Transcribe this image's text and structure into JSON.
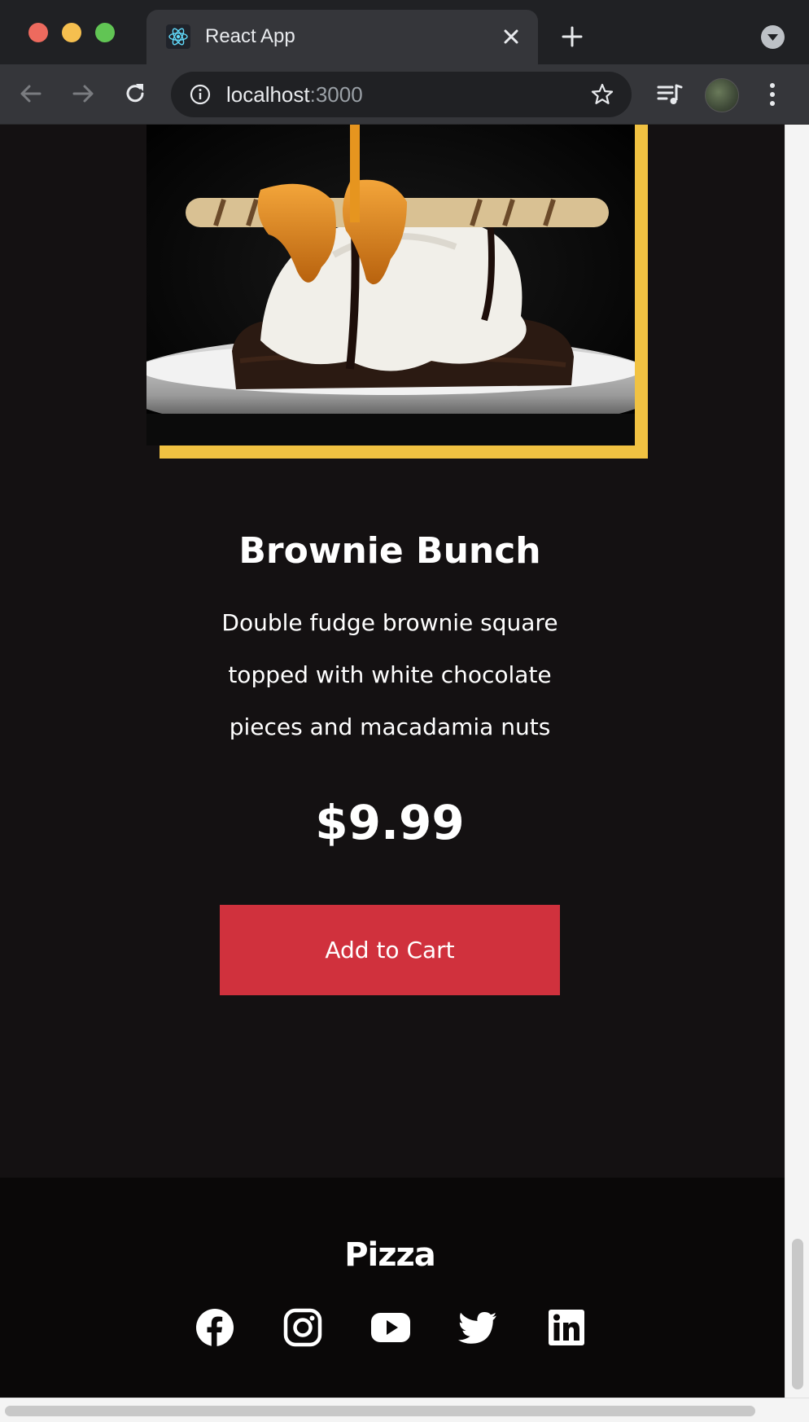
{
  "browser": {
    "tab_title": "React App",
    "url_host": "localhost",
    "url_port": ":3000"
  },
  "product": {
    "image_alt": "Brownie with ice cream, caramel and chocolate drizzle",
    "title": "Brownie Bunch",
    "description": "Double fudge brownie square topped with white chocolate pieces and macadamia nuts",
    "price": "$9.99",
    "cart_label": "Add to Cart"
  },
  "footer": {
    "logo": "Pizza",
    "social": [
      "facebook-icon",
      "instagram-icon",
      "youtube-icon",
      "twitter-icon",
      "linkedin-icon"
    ]
  },
  "colors": {
    "page_bg": "#141112",
    "frame_accent": "#f1c242",
    "button_bg": "#d0313d",
    "footer_bg": "#0a0808"
  }
}
